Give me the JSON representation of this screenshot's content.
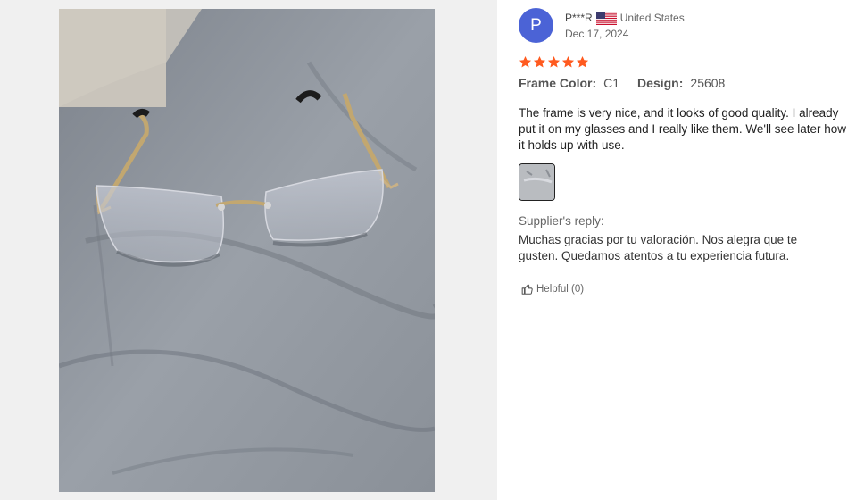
{
  "review": {
    "avatar_initial": "P",
    "reviewer_name": "P***R",
    "country": "United States",
    "date": "Dec 17, 2024",
    "rating": 5,
    "attributes": [
      {
        "key": "Frame Color",
        "value": "C1"
      },
      {
        "key": "Design",
        "value": "25608"
      }
    ],
    "text": "The frame is very nice, and it looks of good quality. I already put it on my glasses and I really like them. We'll see later how it holds up with use.",
    "helpful_label": "Helpful (0)"
  },
  "supplier_reply": {
    "label": "Supplier's reply:",
    "text": "Muchas gracias por tu valoración. Nos alegra que te gusten. Quedamos atentos a tu experiencia futura."
  },
  "icons": {
    "flag": "us-flag-icon",
    "star": "star-icon",
    "helpful": "thumbs-up-icon"
  },
  "colors": {
    "avatar_bg": "#4b63d6",
    "star": "#ff5a1f"
  }
}
